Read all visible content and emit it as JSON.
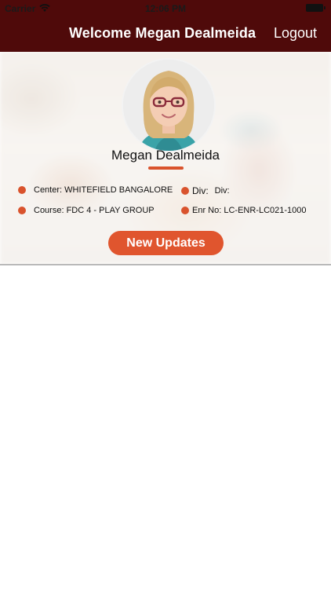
{
  "status_bar": {
    "carrier": "Carrier",
    "time": "12:06 PM"
  },
  "header": {
    "title": "Welcome Megan Dealmeida",
    "logout_label": "Logout",
    "background_color": "#4f0a0a"
  },
  "profile": {
    "name": "Megan Dealmeida",
    "accent_color": "#d9532d",
    "center": "Center: WHITEFIELD BANGALORE",
    "div_label": "Div:",
    "div_value": "Div:",
    "course": "Course: FDC 4 - PLAY GROUP",
    "enr_no": "Enr No: LC-ENR-LC021-1000"
  },
  "actions": {
    "new_updates_label": "New Updates"
  }
}
